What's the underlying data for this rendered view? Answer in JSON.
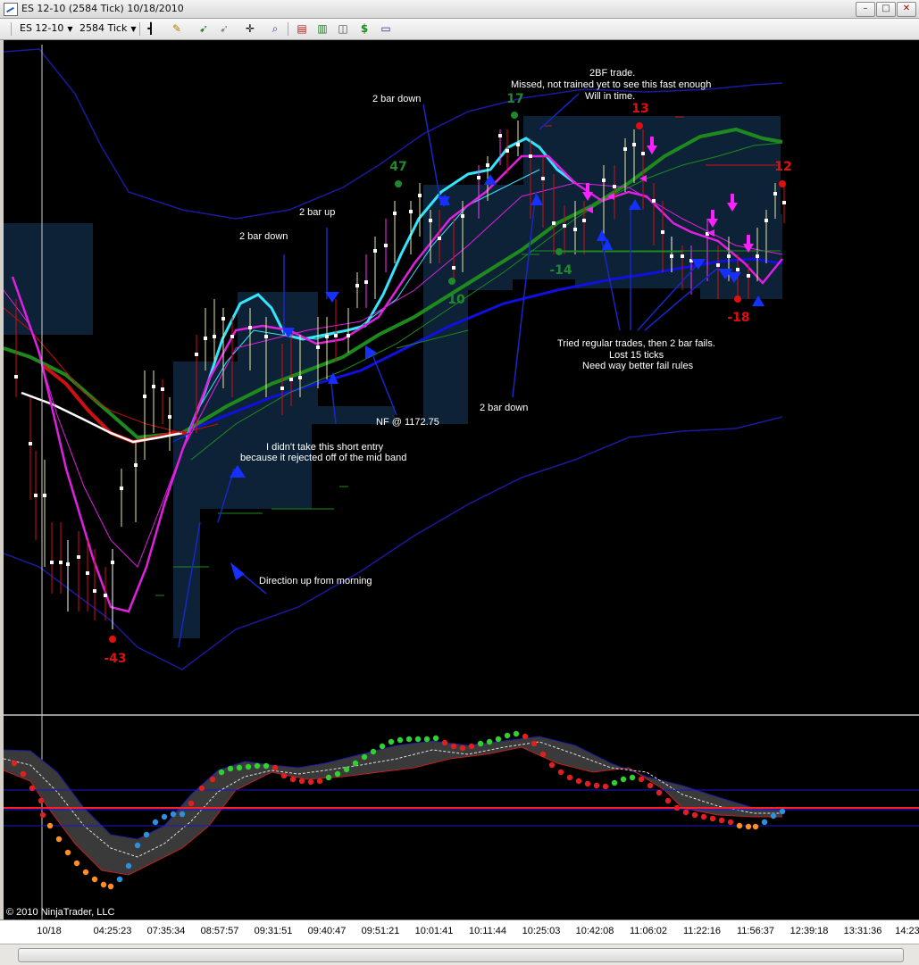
{
  "window": {
    "title": "ES 12-10 (2584 Tick)  10/18/2010",
    "controls": {
      "minimize": "–",
      "maximize": "□",
      "close": "✕"
    }
  },
  "toolbar": {
    "instrument": "ES 12-10",
    "interval": "2584 Tick",
    "icons": [
      "bars-style-icon",
      "pencil-draw-icon",
      "crosshair-icon",
      "pointer-icon",
      "zoom-icon",
      "indicators-icon",
      "strategies-icon",
      "chart-trader-icon",
      "dollar-icon",
      "properties-icon"
    ]
  },
  "time_axis": {
    "labels": [
      "10/18",
      "04:25:23",
      "07:35:34",
      "08:57:57",
      "09:31:51",
      "09:40:47",
      "09:51:21",
      "10:01:41",
      "10:11:44",
      "10:25:03",
      "10:42:08",
      "11:06:02",
      "11:22:16",
      "11:56:37",
      "12:39:18",
      "13:31:36",
      "14:23"
    ]
  },
  "annotations": {
    "bf2_trade": "2BF trade.",
    "missed": "Missed, not trained yet to see this fast enough",
    "will": "Will in time.",
    "bar2down_top": "2 bar down",
    "bar2up": "2 bar up",
    "bar2down_left": "2 bar down",
    "tried": "Tried regular trades, then 2 bar fails.",
    "lost": "Lost 15 ticks",
    "need": "Need way better fail rules",
    "nf": "NF @ 1172.75",
    "didnt_take": "I didn't take this short entry",
    "rejected": "because it rejected off of the mid band",
    "bar2down_bottom": "2 bar down",
    "direction": "Direction up from morning"
  },
  "trade_labels": [
    {
      "text": "17",
      "color": "#1f8a2a"
    },
    {
      "text": "13",
      "color": "#e01010"
    },
    {
      "text": "12",
      "color": "#e01010"
    },
    {
      "text": "47",
      "color": "#1f8a2a"
    },
    {
      "text": "-14",
      "color": "#1f8a2a"
    },
    {
      "text": "10",
      "color": "#1f8a2a"
    },
    {
      "text": "-18",
      "color": "#e01010"
    },
    {
      "text": "-43",
      "color": "#e01010"
    }
  ],
  "copyright": "© 2010 NinjaTrader, LLC",
  "colors": {
    "background": "#000000",
    "channel": "#0d2236",
    "band": "#1a1aa0",
    "cyan_ma": "#33e6ff",
    "green_ma": "#1e8a1e",
    "blue_ma": "#1010e0",
    "magenta_ma": "#e020e0",
    "red_ma": "#d01010",
    "arrow_blue": "#1530ff",
    "arrow_magenta": "#ff20ff"
  }
}
